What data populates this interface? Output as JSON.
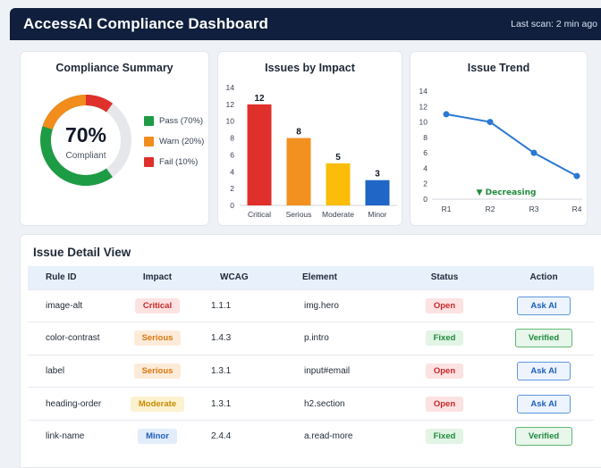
{
  "header": {
    "title": "AccessAI Compliance Dashboard",
    "last_scan": "Last scan: 2 min ago"
  },
  "colors": {
    "header_bg": "#0f1f3d",
    "pass": "#1e9b45",
    "warn": "#f28c1c",
    "fail": "#e0302b",
    "critical": "#e0302b",
    "serious": "#f29020",
    "moderate": "#fbbd09",
    "minor": "#1f66c6",
    "trend_line": "#2a78d2"
  },
  "summary": {
    "title": "Compliance Summary",
    "percent": "70%",
    "caption": "Compliant",
    "legend": [
      {
        "label": "Pass (70%)",
        "color": "#1e9b45"
      },
      {
        "label": "Warn (20%)",
        "color": "#f28c1c"
      },
      {
        "label": "Fail (10%)",
        "color": "#e0302b"
      }
    ]
  },
  "chart_data": [
    {
      "type": "pie",
      "title": "Compliance Summary",
      "categories": [
        "Pass",
        "Warn",
        "Fail"
      ],
      "values": [
        70,
        20,
        10
      ],
      "center_label": "70%",
      "center_sublabel": "Compliant",
      "legend_position": "right",
      "colors": [
        "#1e9b45",
        "#f28c1c",
        "#e0302b"
      ]
    },
    {
      "type": "bar",
      "title": "Issues by Impact",
      "categories": [
        "Critical",
        "Serious",
        "Moderate",
        "Minor"
      ],
      "values": [
        12,
        8,
        5,
        3
      ],
      "ylim": [
        0,
        14
      ],
      "yticks": [
        0,
        2,
        4,
        6,
        8,
        10,
        12,
        14
      ],
      "grid": false,
      "colors": [
        "#e0302b",
        "#f29020",
        "#fbbd09",
        "#1f66c6"
      ]
    },
    {
      "type": "line",
      "title": "Issue Trend",
      "categories": [
        "R1",
        "R2",
        "R3",
        "R4"
      ],
      "values": [
        11,
        10,
        6,
        3
      ],
      "ylim": [
        0,
        14
      ],
      "yticks": [
        0,
        2,
        4,
        6,
        8,
        10,
        12,
        14
      ],
      "grid": false,
      "annotation": "▼ Decreasing",
      "color": "#2a78d2"
    }
  ],
  "detail": {
    "title": "Issue Detail View",
    "columns": [
      "Rule ID",
      "Impact",
      "WCAG",
      "Element",
      "Status",
      "Action"
    ],
    "rows": [
      {
        "rule": "image-alt",
        "impact": "Critical",
        "wcag": "1.1.1",
        "element": "img.hero",
        "status": "Open",
        "action": "Ask AI"
      },
      {
        "rule": "color-contrast",
        "impact": "Serious",
        "wcag": "1.4.3",
        "element": "p.intro",
        "status": "Fixed",
        "action": "Verified"
      },
      {
        "rule": "label",
        "impact": "Serious",
        "wcag": "1.3.1",
        "element": "input#email",
        "status": "Open",
        "action": "Ask AI"
      },
      {
        "rule": "heading-order",
        "impact": "Moderate",
        "wcag": "1.3.1",
        "element": "h2.section",
        "status": "Open",
        "action": "Ask AI"
      },
      {
        "rule": "link-name",
        "impact": "Minor",
        "wcag": "2.4.4",
        "element": "a.read-more",
        "status": "Fixed",
        "action": "Verified"
      }
    ]
  }
}
